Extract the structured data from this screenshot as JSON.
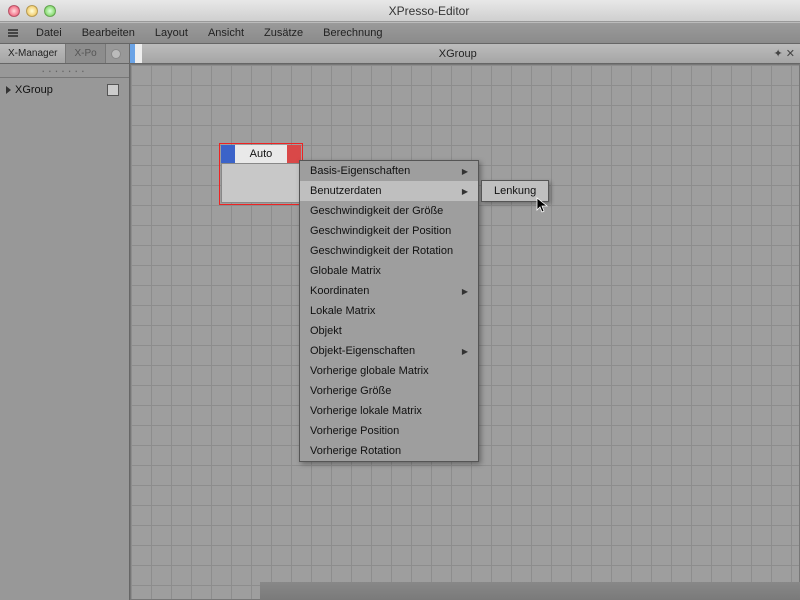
{
  "window": {
    "title": "XPresso-Editor"
  },
  "menubar": [
    "Datei",
    "Bearbeiten",
    "Layout",
    "Ansicht",
    "Zusätze",
    "Berechnung"
  ],
  "sidebar": {
    "tabs": {
      "active": "X-Manager",
      "inactive": "X-Po"
    },
    "tree": {
      "root": "XGroup"
    }
  },
  "canvas": {
    "title": "XGroup"
  },
  "node": {
    "title": "Auto"
  },
  "context_menu": {
    "items": [
      {
        "label": "Basis-Eigenschaften",
        "submenu": true
      },
      {
        "label": "Benutzerdaten",
        "submenu": true,
        "hover": true
      },
      {
        "label": "Geschwindigkeit der Größe",
        "submenu": false
      },
      {
        "label": "Geschwindigkeit der Position",
        "submenu": false
      },
      {
        "label": "Geschwindigkeit der Rotation",
        "submenu": false
      },
      {
        "label": "Globale Matrix",
        "submenu": false
      },
      {
        "label": "Koordinaten",
        "submenu": true
      },
      {
        "label": "Lokale Matrix",
        "submenu": false
      },
      {
        "label": "Objekt",
        "submenu": false
      },
      {
        "label": "Objekt-Eigenschaften",
        "submenu": true
      },
      {
        "label": "Vorherige globale Matrix",
        "submenu": false
      },
      {
        "label": "Vorherige Größe",
        "submenu": false
      },
      {
        "label": "Vorherige lokale Matrix",
        "submenu": false
      },
      {
        "label": "Vorherige Position",
        "submenu": false
      },
      {
        "label": "Vorherige Rotation",
        "submenu": false
      }
    ],
    "submenu": {
      "items": [
        "Lenkung"
      ]
    }
  }
}
